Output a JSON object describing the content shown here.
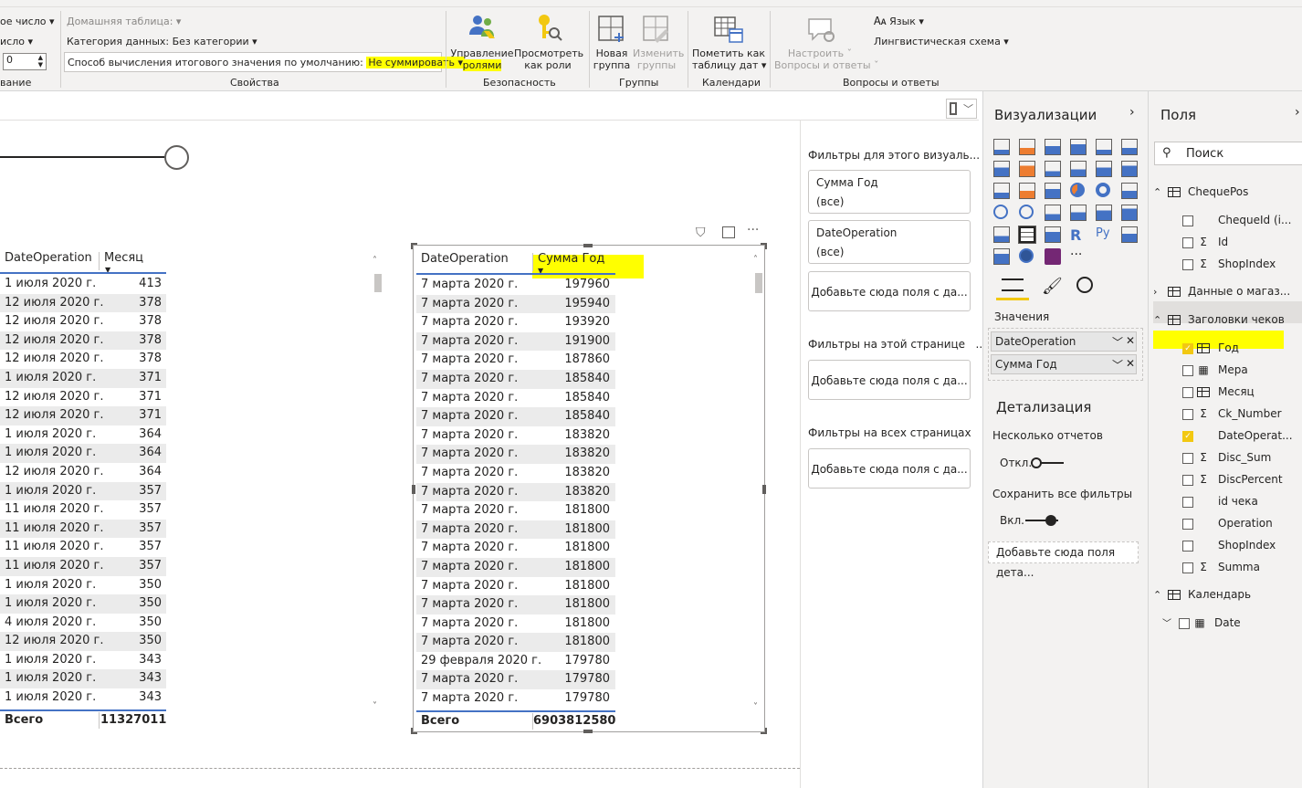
{
  "ribbon": {
    "left_col": {
      "item1": "ое число",
      "item2": "исло",
      "stepper_value": "0",
      "group": "вание"
    },
    "props": {
      "home_table_label": "Домашняя таблица:",
      "data_category": "Категория данных: Без категории",
      "summarize_label": "Способ вычисления итогового значения по умолчанию:",
      "summarize_value": "Не суммировать",
      "group": "Свойства"
    },
    "security": {
      "manage_roles": "Управление",
      "manage_roles_2": "ролями",
      "view_roles": "Просмотреть",
      "view_roles_2": "как роли",
      "group": "Безопасность"
    },
    "groups": {
      "new_group": "Новая",
      "new_group_2": "группа",
      "edit_groups": "Изменить",
      "edit_groups_2": "группы",
      "group": "Группы"
    },
    "calendars": {
      "mark_date": "Пометить как",
      "mark_date_2": "таблицу дат",
      "group": "Календари"
    },
    "qa": {
      "setup": "Настроить",
      "setup_2": "Вопросы и ответы",
      "language": "Язык",
      "ling": "Лингвистическая схема",
      "group": "Вопросы и ответы"
    }
  },
  "table_left": {
    "headers": [
      "DateOperation",
      "Месяц"
    ],
    "rows": [
      [
        "1 июля 2020 г.",
        "413"
      ],
      [
        "12 июля 2020 г.",
        "378"
      ],
      [
        "12 июля 2020 г.",
        "378"
      ],
      [
        "12 июля 2020 г.",
        "378"
      ],
      [
        "12 июля 2020 г.",
        "378"
      ],
      [
        "1 июля 2020 г.",
        "371"
      ],
      [
        "12 июля 2020 г.",
        "371"
      ],
      [
        "12 июля 2020 г.",
        "371"
      ],
      [
        "1 июля 2020 г.",
        "364"
      ],
      [
        "1 июля 2020 г.",
        "364"
      ],
      [
        "12 июля 2020 г.",
        "364"
      ],
      [
        "1 июля 2020 г.",
        "357"
      ],
      [
        "11 июля 2020 г.",
        "357"
      ],
      [
        "11 июля 2020 г.",
        "357"
      ],
      [
        "11 июля 2020 г.",
        "357"
      ],
      [
        "11 июля 2020 г.",
        "357"
      ],
      [
        "1 июля 2020 г.",
        "350"
      ],
      [
        "1 июля 2020 г.",
        "350"
      ],
      [
        "4 июля 2020 г.",
        "350"
      ],
      [
        "12 июля 2020 г.",
        "350"
      ],
      [
        "1 июля 2020 г.",
        "343"
      ],
      [
        "1 июля 2020 г.",
        "343"
      ],
      [
        "1 июля 2020 г.",
        "343"
      ]
    ],
    "total_label": "Всего",
    "total_value": "11327011"
  },
  "table_right": {
    "headers": [
      "DateOperation",
      "Сумма Год"
    ],
    "rows": [
      [
        "7 марта 2020 г.",
        "197960"
      ],
      [
        "7 марта 2020 г.",
        "195940"
      ],
      [
        "7 марта 2020 г.",
        "193920"
      ],
      [
        "7 марта 2020 г.",
        "191900"
      ],
      [
        "7 марта 2020 г.",
        "187860"
      ],
      [
        "7 марта 2020 г.",
        "185840"
      ],
      [
        "7 марта 2020 г.",
        "185840"
      ],
      [
        "7 марта 2020 г.",
        "185840"
      ],
      [
        "7 марта 2020 г.",
        "183820"
      ],
      [
        "7 марта 2020 г.",
        "183820"
      ],
      [
        "7 марта 2020 г.",
        "183820"
      ],
      [
        "7 марта 2020 г.",
        "183820"
      ],
      [
        "7 марта 2020 г.",
        "181800"
      ],
      [
        "7 марта 2020 г.",
        "181800"
      ],
      [
        "7 марта 2020 г.",
        "181800"
      ],
      [
        "7 марта 2020 г.",
        "181800"
      ],
      [
        "7 марта 2020 г.",
        "181800"
      ],
      [
        "7 марта 2020 г.",
        "181800"
      ],
      [
        "7 марта 2020 г.",
        "181800"
      ],
      [
        "7 марта 2020 г.",
        "181800"
      ],
      [
        "29 февраля 2020 г.",
        "179780"
      ],
      [
        "7 марта 2020 г.",
        "179780"
      ],
      [
        "7 марта 2020 г.",
        "179780"
      ]
    ],
    "total_label": "Всего",
    "total_value": "6903812580"
  },
  "filters": {
    "visual_header": "Фильтры для этого визуаль...",
    "card1_title": "Сумма Год",
    "card1_value": "(все)",
    "card2_title": "DateOperation",
    "card2_value": "(все)",
    "add_here": "Добавьте сюда поля с да...",
    "page_header": "Фильтры на этой странице",
    "all_header": "Фильтры на всех страницах",
    "more": "..."
  },
  "viz": {
    "title": "Визуализации",
    "values_label": "Значения",
    "well1": "DateOperation",
    "well2": "Сумма Год",
    "drill_title": "Детализация",
    "multi_reports": "Несколько отчетов",
    "off": "Откл.",
    "keep_filters": "Сохранить все фильтры",
    "on": "Вкл.",
    "drill_add": "Добавьте сюда поля дета...",
    "more": "..."
  },
  "fields": {
    "title": "Поля",
    "search_placeholder": "Поиск",
    "tables": [
      {
        "name": "ChequePos",
        "items": [
          {
            "name": "ChequeId (i...",
            "kind": "none",
            "checked": false
          },
          {
            "name": "Id",
            "kind": "sigma",
            "checked": false
          },
          {
            "name": "ShopIndex",
            "kind": "sigma",
            "checked": false
          }
        ]
      },
      {
        "name": "Данные о магаз...",
        "items": []
      },
      {
        "name": "Заголовки чеков",
        "items": [
          {
            "name": "Год",
            "kind": "table",
            "checked": true
          },
          {
            "name": "Мера",
            "kind": "calc",
            "checked": false
          },
          {
            "name": "Месяц",
            "kind": "table",
            "checked": false
          },
          {
            "name": "Ck_Number",
            "kind": "sigma",
            "checked": false
          },
          {
            "name": "DateOperat...",
            "kind": "none",
            "checked": true
          },
          {
            "name": "Disc_Sum",
            "kind": "sigma",
            "checked": false
          },
          {
            "name": "DiscPercent",
            "kind": "sigma",
            "checked": false
          },
          {
            "name": "id чека",
            "kind": "none",
            "checked": false
          },
          {
            "name": "Operation",
            "kind": "none",
            "checked": false
          },
          {
            "name": "ShopIndex",
            "kind": "none",
            "checked": false
          },
          {
            "name": "Summa",
            "kind": "sigma",
            "checked": false
          }
        ]
      },
      {
        "name": "Календарь",
        "items": [
          {
            "name": "Date",
            "kind": "cal",
            "checked": false
          }
        ]
      }
    ]
  },
  "colors": {
    "highlight": "#ffff00",
    "check": "#f2c811",
    "accent": "#4472c4"
  }
}
